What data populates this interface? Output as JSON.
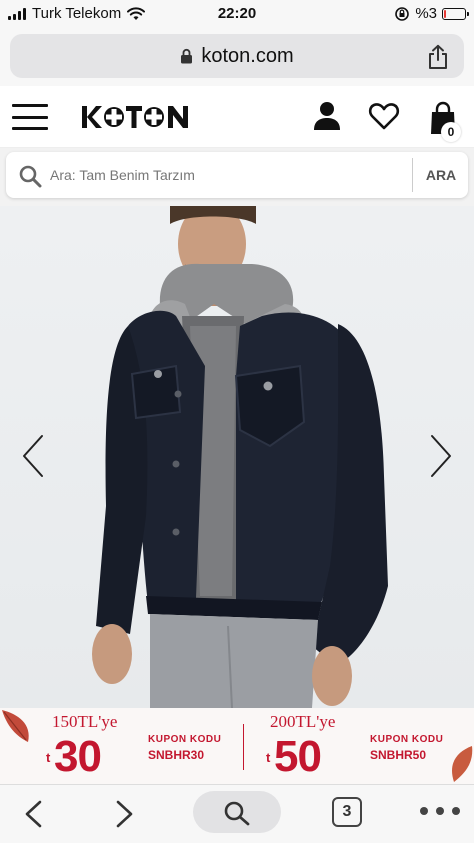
{
  "status_bar": {
    "carrier": "Turk Telekom",
    "time": "22:20",
    "battery": "%3",
    "battery_level": 0.03
  },
  "browser": {
    "url": "koton.com"
  },
  "header": {
    "logo": "KOTON",
    "cart_count": "0"
  },
  "search": {
    "placeholder": "Ara: Tam Benim Tarzım",
    "button_label": "ARA"
  },
  "promo": {
    "left": {
      "amount_label": "150TL'ye",
      "currency": "t",
      "discount": "30",
      "code_label": "KUPON KODU",
      "code": "SNBHR30"
    },
    "right": {
      "amount_label": "200TL'ye",
      "currency": "t",
      "discount": "50",
      "code_label": "KUPON KODU",
      "code": "SNBHR50"
    }
  },
  "toolbar": {
    "tab_count": "3"
  },
  "colors": {
    "brand": "#111111",
    "promo_red": "#c3172f",
    "jacket": "#1c2230"
  }
}
